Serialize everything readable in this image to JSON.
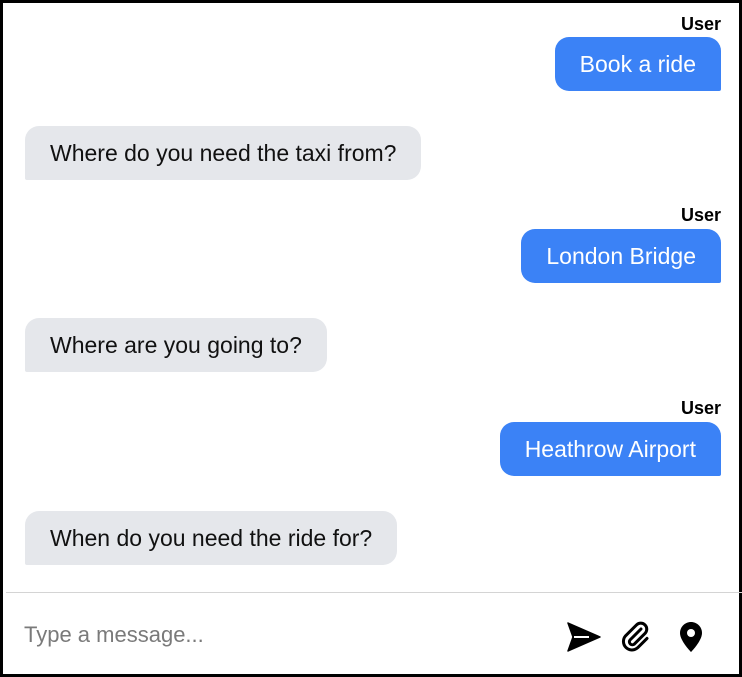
{
  "chat": {
    "messages": [
      {
        "sender": "User",
        "text": "Book a ride"
      },
      {
        "sender": "",
        "text": "Where do you need the taxi from?"
      },
      {
        "sender": "User",
        "text": "London Bridge"
      },
      {
        "sender": "",
        "text": "Where are you going to?"
      },
      {
        "sender": "User",
        "text": "Heathrow Airport"
      },
      {
        "sender": "",
        "text": "When do you need the ride for?"
      }
    ]
  },
  "composer": {
    "placeholder": "Type a message...",
    "value": "",
    "icons": [
      "send-icon",
      "paperclip-icon",
      "location-pin-icon"
    ]
  },
  "colors": {
    "user_bubble": "#3b82f6",
    "bot_bubble": "#e5e7eb"
  }
}
